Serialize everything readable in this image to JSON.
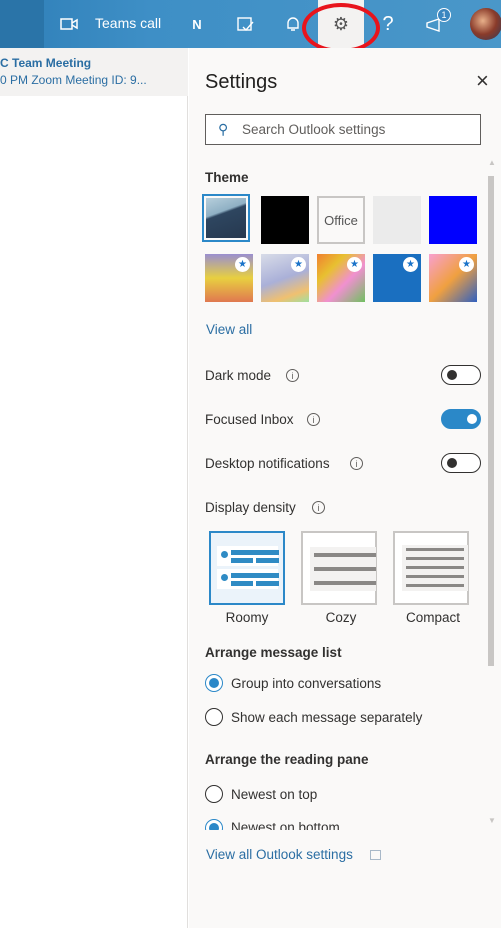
{
  "topbar": {
    "teams_call": "Teams call",
    "notification_count": "1",
    "icons": [
      "video-icon",
      "onenote-icon",
      "todo-icon",
      "bell-icon",
      "gear-icon",
      "help-icon",
      "megaphone-icon",
      "avatar"
    ]
  },
  "mail_item": {
    "title": "C Team Meeting",
    "preview": "0 PM Zoom Meeting ID: 9..."
  },
  "settings": {
    "title": "Settings",
    "search_placeholder": "Search Outlook settings",
    "theme_heading": "Theme",
    "theme_office": "Office",
    "view_all": "View all",
    "dark_mode": "Dark mode",
    "dark_mode_on": false,
    "focused_inbox": "Focused Inbox",
    "focused_inbox_on": true,
    "desktop_notifications": "Desktop notifications",
    "desktop_notifications_on": false,
    "display_density": "Display density",
    "density_options": [
      "Roomy",
      "Cozy",
      "Compact"
    ],
    "density_selected": "Roomy",
    "arrange_list": "Arrange message list",
    "list_options": [
      "Group into conversations",
      "Show each message separately"
    ],
    "arrange_pane": "Arrange the reading pane",
    "pane_options": [
      "Newest on top",
      "Newest on bottom"
    ],
    "view_all_outlook": "View all Outlook settings",
    "accent": "#2b88c8"
  }
}
